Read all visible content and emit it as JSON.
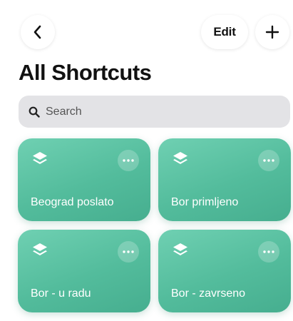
{
  "header": {
    "edit_label": "Edit",
    "title": "All Shortcuts"
  },
  "search": {
    "placeholder": "Search"
  },
  "shortcuts": [
    {
      "label": "Beograd poslato",
      "icon": "layers-icon"
    },
    {
      "label": "Bor primljeno",
      "icon": "layers-icon"
    },
    {
      "label": "Bor - u radu",
      "icon": "layers-icon"
    },
    {
      "label": "Bor - zavrseno",
      "icon": "layers-icon"
    }
  ],
  "colors": {
    "tile": "#53bc9c",
    "search_background": "#e3e3e6",
    "text": "#111111"
  }
}
